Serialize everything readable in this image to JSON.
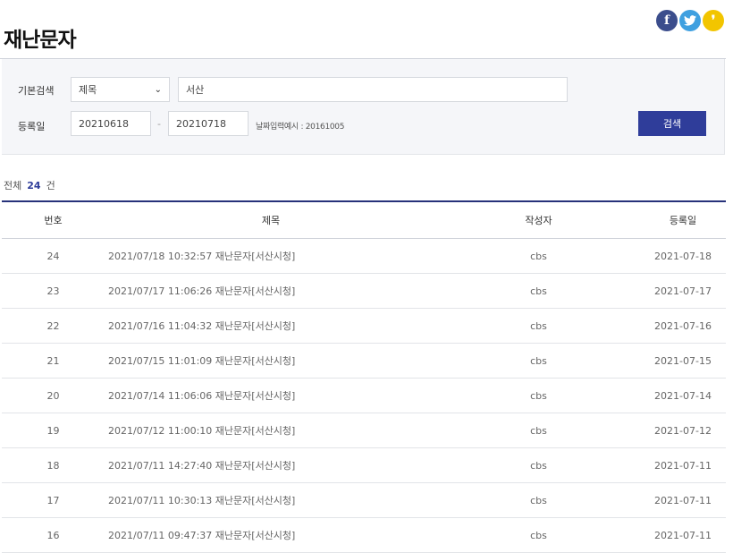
{
  "page": {
    "title": "재난문자"
  },
  "social": [
    {
      "name": "facebook",
      "glyph": "f",
      "color": "#3b4d8c"
    },
    {
      "name": "twitter",
      "glyph": "",
      "color": "#3fa0e0"
    },
    {
      "name": "kakaostory",
      "glyph": "❜",
      "color": "#f2c500"
    }
  ],
  "search": {
    "basic_label": "기본검색",
    "field_select": "제목",
    "keyword": "서산",
    "date_label": "등록일",
    "date_from": "20210618",
    "date_sep": "-",
    "date_to": "20210718",
    "date_hint": "날짜입력예시 : 20161005",
    "button": "검색"
  },
  "summary": {
    "prefix": "전체",
    "count": "24",
    "suffix": "건"
  },
  "table": {
    "headers": {
      "no": "번호",
      "title": "제목",
      "writer": "작성자",
      "date": "등록일"
    },
    "rows": [
      {
        "no": "24",
        "title": "2021/07/18 10:32:57 재난문자[서산시청]",
        "writer": "cbs",
        "date": "2021-07-18"
      },
      {
        "no": "23",
        "title": "2021/07/17 11:06:26 재난문자[서산시청]",
        "writer": "cbs",
        "date": "2021-07-17"
      },
      {
        "no": "22",
        "title": "2021/07/16 11:04:32 재난문자[서산시청]",
        "writer": "cbs",
        "date": "2021-07-16"
      },
      {
        "no": "21",
        "title": "2021/07/15 11:01:09 재난문자[서산시청]",
        "writer": "cbs",
        "date": "2021-07-15"
      },
      {
        "no": "20",
        "title": "2021/07/14 11:06:06 재난문자[서산시청]",
        "writer": "cbs",
        "date": "2021-07-14"
      },
      {
        "no": "19",
        "title": "2021/07/12 11:00:10 재난문자[서산시청]",
        "writer": "cbs",
        "date": "2021-07-12"
      },
      {
        "no": "18",
        "title": "2021/07/11 14:27:40 재난문자[서산시청]",
        "writer": "cbs",
        "date": "2021-07-11"
      },
      {
        "no": "17",
        "title": "2021/07/11 10:30:13 재난문자[서산시청]",
        "writer": "cbs",
        "date": "2021-07-11"
      },
      {
        "no": "16",
        "title": "2021/07/11 09:47:37 재난문자[서산시청]",
        "writer": "cbs",
        "date": "2021-07-11"
      }
    ]
  }
}
